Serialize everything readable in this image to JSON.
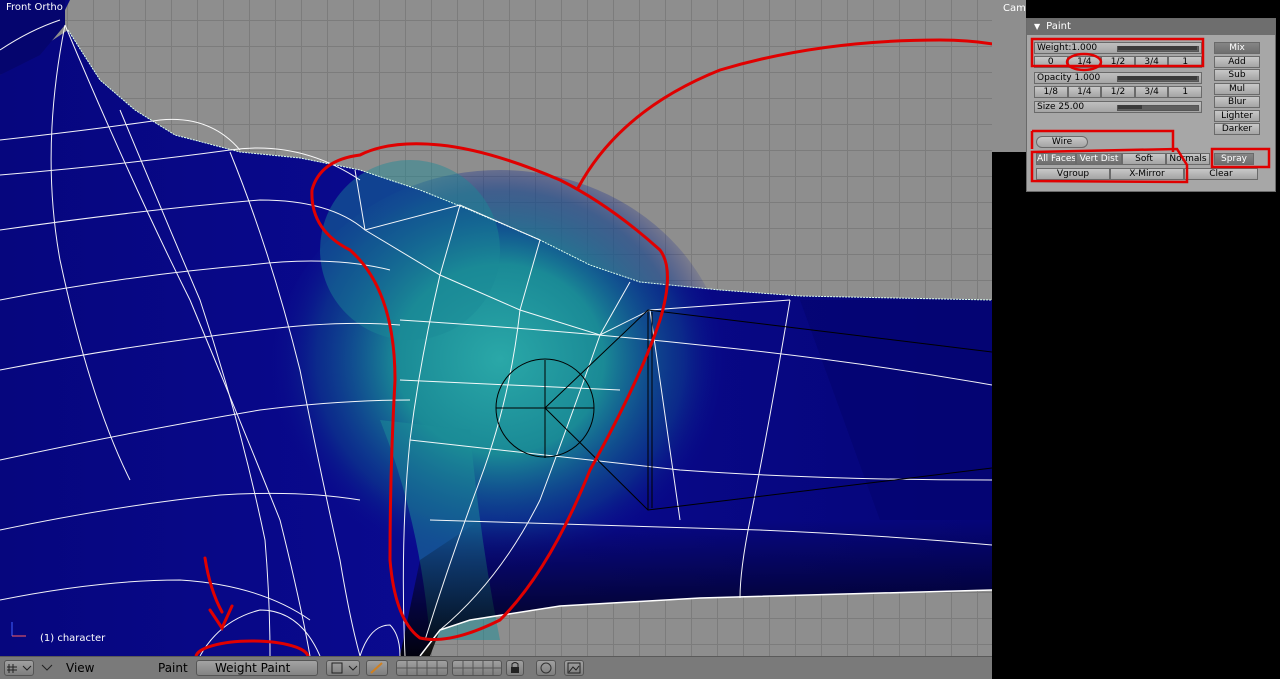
{
  "viewport": {
    "view_name": "Front Ortho",
    "object_label": "(1) character"
  },
  "camera_label": "Cam",
  "paint_panel": {
    "title": "Paint",
    "weight_label": "Weight:1.000",
    "weight_fraction": 1.0,
    "weight_presets": [
      "0",
      "1/4",
      "1/2",
      "3/4",
      "1"
    ],
    "opacity_label": "Opacity 1.000",
    "opacity_fraction": 1.0,
    "opacity_presets": [
      "1/8",
      "1/4",
      "1/2",
      "3/4",
      "1"
    ],
    "size_label": "Size 25.00",
    "size_fraction": 0.3,
    "blend_modes": [
      "Mix",
      "Add",
      "Sub",
      "Mul",
      "Blur",
      "Lighter",
      "Darker"
    ],
    "selected_blend": "Mix",
    "wire_label": "Wire",
    "options": [
      "All Faces",
      "Vert Dist",
      "Soft",
      "Normals",
      "Spray"
    ],
    "vgroup_label": "Vgroup",
    "xmirror_label": "X-Mirror",
    "clear_label": "Clear"
  },
  "bottombar": {
    "view_menu": "View",
    "paint_menu": "Paint",
    "mode": "Weight Paint"
  },
  "colors": {
    "annotation": "#e00000",
    "mesh_dark": "#0a0a8a",
    "mesh_highlight": "#1e9e9e",
    "grid_background": "#8e8e8e"
  }
}
